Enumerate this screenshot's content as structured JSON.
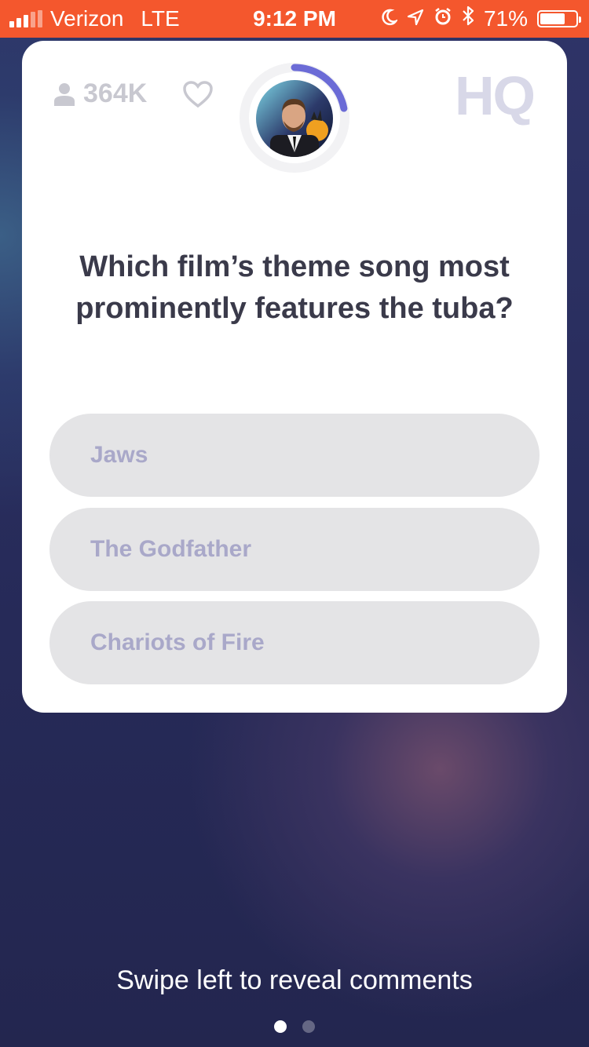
{
  "status_bar": {
    "carrier": "Verizon",
    "network": "LTE",
    "time": "9:12 PM",
    "battery": "71%",
    "battery_level": 0.71
  },
  "header": {
    "viewers": "364K",
    "logo": "HQ",
    "timer_progress": 0.22
  },
  "question": "Which film’s theme song most prominently features the tuba?",
  "answers": [
    {
      "label": "Jaws"
    },
    {
      "label": "The Godfather"
    },
    {
      "label": "Chariots of Fire"
    }
  ],
  "footer": {
    "hint": "Swipe left to reveal comments",
    "pages": 2,
    "active_page": 1
  },
  "colors": {
    "status_bar": "#f4572d",
    "timer_arc": "#6b6bd6",
    "answer_bg": "#e4e4e6",
    "answer_text": "#a9a8c9"
  }
}
